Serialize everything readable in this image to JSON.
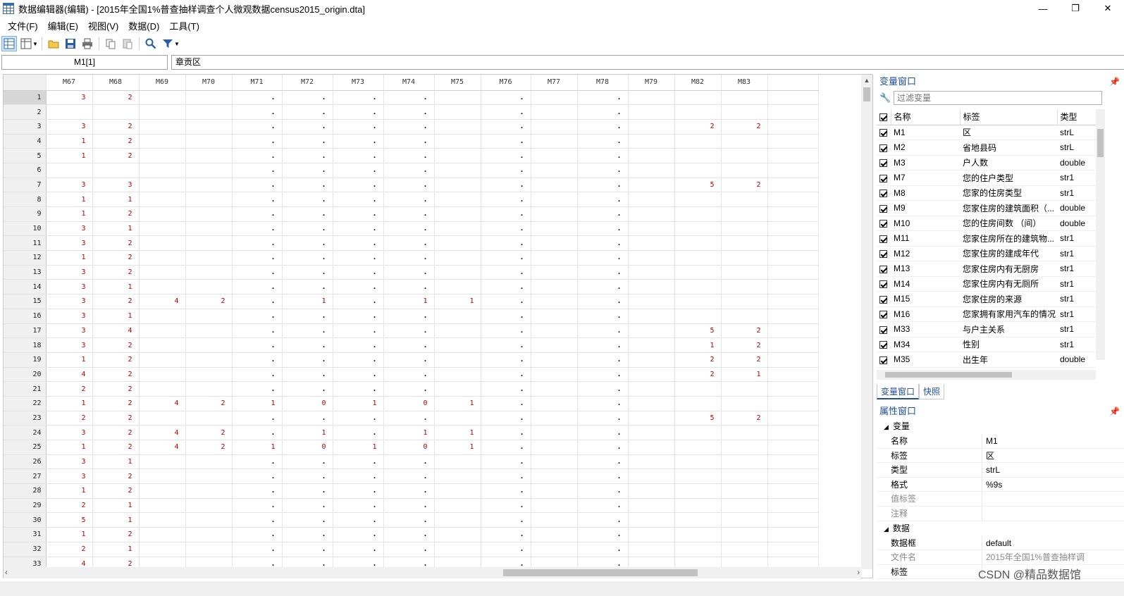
{
  "window": {
    "title": "数据编辑器(编辑) - [2015年全国1%普查抽样调查个人微观数据census2015_origin.dta]",
    "controls": [
      "—",
      "❐",
      "✕"
    ]
  },
  "menu": [
    "文件(F)",
    "编辑(E)",
    "视图(V)",
    "数据(D)",
    "工具(T)"
  ],
  "cellbar": {
    "ref": "M1[1]",
    "value": "章贡区"
  },
  "grid": {
    "columns": [
      "M67",
      "M68",
      "M69",
      "M70",
      "M71",
      "M72",
      "M73",
      "M74",
      "M75",
      "M76",
      "M77",
      "M78",
      "M79",
      "M82",
      "M83"
    ],
    "rows": [
      [
        "1",
        "3",
        "2",
        "",
        "",
        ".",
        ".",
        ".",
        ".",
        "",
        ".",
        "",
        ".",
        "",
        "",
        ""
      ],
      [
        "2",
        "",
        "",
        "",
        "",
        ".",
        ".",
        ".",
        ".",
        "",
        ".",
        "",
        ".",
        "",
        "",
        ""
      ],
      [
        "3",
        "3",
        "2",
        "",
        "",
        ".",
        ".",
        ".",
        ".",
        "",
        ".",
        "",
        ".",
        "",
        "2",
        "2"
      ],
      [
        "4",
        "1",
        "2",
        "",
        "",
        ".",
        ".",
        ".",
        ".",
        "",
        ".",
        "",
        ".",
        "",
        "",
        ""
      ],
      [
        "5",
        "1",
        "2",
        "",
        "",
        ".",
        ".",
        ".",
        ".",
        "",
        ".",
        "",
        ".",
        "",
        "",
        ""
      ],
      [
        "6",
        "",
        "",
        "",
        "",
        ".",
        ".",
        ".",
        ".",
        "",
        ".",
        "",
        ".",
        "",
        "",
        ""
      ],
      [
        "7",
        "3",
        "3",
        "",
        "",
        ".",
        ".",
        ".",
        ".",
        "",
        ".",
        "",
        ".",
        "",
        "5",
        "2"
      ],
      [
        "8",
        "1",
        "1",
        "",
        "",
        ".",
        ".",
        ".",
        ".",
        "",
        ".",
        "",
        ".",
        "",
        "",
        ""
      ],
      [
        "9",
        "1",
        "2",
        "",
        "",
        ".",
        ".",
        ".",
        ".",
        "",
        ".",
        "",
        ".",
        "",
        "",
        ""
      ],
      [
        "10",
        "3",
        "1",
        "",
        "",
        ".",
        ".",
        ".",
        ".",
        "",
        ".",
        "",
        ".",
        "",
        "",
        ""
      ],
      [
        "11",
        "3",
        "2",
        "",
        "",
        ".",
        ".",
        ".",
        ".",
        "",
        ".",
        "",
        ".",
        "",
        "",
        ""
      ],
      [
        "12",
        "1",
        "2",
        "",
        "",
        ".",
        ".",
        ".",
        ".",
        "",
        ".",
        "",
        ".",
        "",
        "",
        ""
      ],
      [
        "13",
        "3",
        "2",
        "",
        "",
        ".",
        ".",
        ".",
        ".",
        "",
        ".",
        "",
        ".",
        "",
        "",
        ""
      ],
      [
        "14",
        "3",
        "1",
        "",
        "",
        ".",
        ".",
        ".",
        ".",
        "",
        ".",
        "",
        ".",
        "",
        "",
        ""
      ],
      [
        "15",
        "3",
        "2",
        "4",
        "2",
        ".",
        "1",
        ".",
        "1",
        "1",
        ".",
        "",
        ".",
        "",
        "",
        ""
      ],
      [
        "16",
        "3",
        "1",
        "",
        "",
        ".",
        ".",
        ".",
        ".",
        "",
        ".",
        "",
        ".",
        "",
        "",
        ""
      ],
      [
        "17",
        "3",
        "4",
        "",
        "",
        ".",
        ".",
        ".",
        ".",
        "",
        ".",
        "",
        ".",
        "",
        "5",
        "2"
      ],
      [
        "18",
        "3",
        "2",
        "",
        "",
        ".",
        ".",
        ".",
        ".",
        "",
        ".",
        "",
        ".",
        "",
        "1",
        "2"
      ],
      [
        "19",
        "1",
        "2",
        "",
        "",
        ".",
        ".",
        ".",
        ".",
        "",
        ".",
        "",
        ".",
        "",
        "2",
        "2"
      ],
      [
        "20",
        "4",
        "2",
        "",
        "",
        ".",
        ".",
        ".",
        ".",
        "",
        ".",
        "",
        ".",
        "",
        "2",
        "1"
      ],
      [
        "21",
        "2",
        "2",
        "",
        "",
        ".",
        ".",
        ".",
        ".",
        "",
        ".",
        "",
        ".",
        "",
        "",
        ""
      ],
      [
        "22",
        "1",
        "2",
        "4",
        "2",
        "1",
        "0",
        "1",
        "0",
        "1",
        ".",
        "",
        ".",
        "",
        "",
        ""
      ],
      [
        "23",
        "2",
        "2",
        "",
        "",
        ".",
        ".",
        ".",
        ".",
        "",
        ".",
        "",
        ".",
        "",
        "5",
        "2"
      ],
      [
        "24",
        "3",
        "2",
        "4",
        "2",
        ".",
        "1",
        ".",
        "1",
        "1",
        ".",
        "",
        ".",
        "",
        "",
        ""
      ],
      [
        "25",
        "1",
        "2",
        "4",
        "2",
        "1",
        "0",
        "1",
        "0",
        "1",
        ".",
        "",
        ".",
        "",
        "",
        ""
      ],
      [
        "26",
        "3",
        "1",
        "",
        "",
        ".",
        ".",
        ".",
        ".",
        "",
        ".",
        "",
        ".",
        "",
        "",
        ""
      ],
      [
        "27",
        "3",
        "2",
        "",
        "",
        ".",
        ".",
        ".",
        ".",
        "",
        ".",
        "",
        ".",
        "",
        "",
        ""
      ],
      [
        "28",
        "1",
        "2",
        "",
        "",
        ".",
        ".",
        ".",
        ".",
        "",
        ".",
        "",
        ".",
        "",
        "",
        ""
      ],
      [
        "29",
        "2",
        "1",
        "",
        "",
        ".",
        ".",
        ".",
        ".",
        "",
        ".",
        "",
        ".",
        "",
        "",
        ""
      ],
      [
        "30",
        "5",
        "1",
        "",
        "",
        ".",
        ".",
        ".",
        ".",
        "",
        ".",
        "",
        ".",
        "",
        "",
        ""
      ],
      [
        "31",
        "1",
        "2",
        "",
        "",
        ".",
        ".",
        ".",
        ".",
        "",
        ".",
        "",
        ".",
        "",
        "",
        ""
      ],
      [
        "32",
        "2",
        "1",
        "",
        "",
        ".",
        ".",
        ".",
        ".",
        "",
        ".",
        "",
        ".",
        "",
        "",
        ""
      ],
      [
        "33",
        "4",
        "2",
        "",
        "",
        ".",
        ".",
        ".",
        ".",
        "",
        ".",
        "",
        ".",
        "",
        "",
        ""
      ]
    ]
  },
  "var_panel": {
    "title": "变量窗口",
    "filter_placeholder": "过滤变量",
    "headers": [
      "名称",
      "标签",
      "类型"
    ],
    "vars": [
      [
        "M1",
        "区",
        "strL"
      ],
      [
        "M2",
        "省地县码",
        "strL"
      ],
      [
        "M3",
        "户人数",
        "double"
      ],
      [
        "M7",
        "您的住户类型",
        "str1"
      ],
      [
        "M8",
        "您家的住房类型",
        "str1"
      ],
      [
        "M9",
        "您家住房的建筑面积（...",
        "double"
      ],
      [
        "M10",
        "您的住房间数 （间）",
        "double"
      ],
      [
        "M11",
        "您家住房所在的建筑物...",
        "str1"
      ],
      [
        "M12",
        "您家住房的建成年代",
        "str1"
      ],
      [
        "M13",
        "您家住房内有无厨房",
        "str1"
      ],
      [
        "M14",
        "您家住房内有无厕所",
        "str1"
      ],
      [
        "M15",
        "您家住房的来源",
        "str1"
      ],
      [
        "M16",
        "您家拥有家用汽车的情况",
        "str1"
      ],
      [
        "M33",
        "与户主关系",
        "str1"
      ],
      [
        "M34",
        "性别",
        "str1"
      ],
      [
        "M35",
        "出生年",
        "double"
      ]
    ],
    "tabs": [
      "变量窗口",
      "快照"
    ]
  },
  "prop_panel": {
    "title": "属性窗口",
    "sections": [
      {
        "name": "变量",
        "rows": [
          [
            "名称",
            "M1",
            false
          ],
          [
            "标签",
            "区",
            false
          ],
          [
            "类型",
            "strL",
            false
          ],
          [
            "格式",
            "%9s",
            false
          ],
          [
            "值标签",
            "",
            true
          ],
          [
            "注释",
            "",
            true
          ]
        ]
      },
      {
        "name": "数据",
        "rows": [
          [
            "数据框",
            "default",
            false
          ],
          [
            "文件名",
            "2015年全国1%普查抽样调",
            true
          ],
          [
            "标签",
            "",
            false
          ]
        ]
      }
    ]
  },
  "watermark": "CSDN @精品数据馆"
}
